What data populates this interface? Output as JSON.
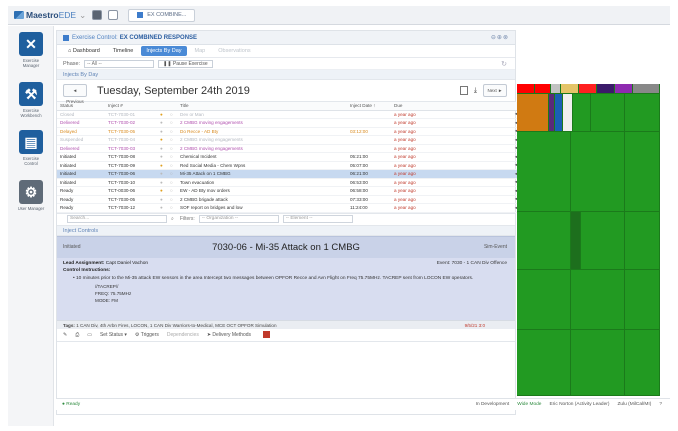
{
  "topbar": {
    "app_name": "Maestro",
    "app_suffix": "EDE",
    "tab_label": "EX COMBINE..."
  },
  "leftnav": [
    {
      "label": "Exercise Manager",
      "icon": "tools-x-icon"
    },
    {
      "label": "Exercise Workbench",
      "icon": "wrench-icon"
    },
    {
      "label": "Exercise Control",
      "icon": "control-panel-icon"
    },
    {
      "label": "User Manager",
      "icon": "gear-icon"
    }
  ],
  "main": {
    "header_prefix": "Exercise Control:",
    "header_title": "EX COMBINED RESPONSE",
    "tabs": [
      {
        "label": "Dashboard",
        "state": "normal"
      },
      {
        "label": "Timeline",
        "state": "normal"
      },
      {
        "label": "Injects By Day",
        "state": "active"
      },
      {
        "label": "Map",
        "state": "muted"
      },
      {
        "label": "Observations",
        "state": "muted"
      }
    ],
    "phase_label": "Phase:",
    "phase_value": "-- All --",
    "pause_label": "Pause Exercise",
    "section_title": "Injects By Day",
    "prev_label": "◄ Previous",
    "next_label": "Next ►",
    "date": "Tuesday, September 24th 2019",
    "columns": [
      "Status",
      "Inject #",
      "",
      "",
      "Title",
      "Inject Date ↑",
      "Due",
      ""
    ],
    "rows": [
      {
        "status": "Closed",
        "num": "TCT-7030-01",
        "title": "Dev or Man",
        "date": "",
        "due": "a year ago",
        "color": "#b3b8c0",
        "sel": false
      },
      {
        "status": "Delivered",
        "num": "TCT-7030-02",
        "title": "2 CMBG moving engagements",
        "date": "",
        "due": "a year ago",
        "color": "#b04fae",
        "sel": false
      },
      {
        "status": "Delayed",
        "num": "TCT-7030-05",
        "title": "Do Recce - AD Bty",
        "date": "03:12:00",
        "due": "a year ago",
        "color": "#d98a1e",
        "sel": false
      },
      {
        "status": "Suspended",
        "num": "TCT-7030-04",
        "title": "2 CMBG moving engagements",
        "date": "",
        "due": "a year ago",
        "color": "#b3b8c0",
        "sel": false
      },
      {
        "status": "Delivered",
        "num": "TCT-7030-03",
        "title": "2 CMBG moving engagements",
        "date": "",
        "due": "a year ago",
        "color": "#b04fae",
        "sel": false
      },
      {
        "status": "Initiated",
        "num": "TCT-7030-08",
        "title": "Chemical Incident",
        "date": "05:21:00",
        "due": "a year ago",
        "color": "#333333",
        "sel": false
      },
      {
        "status": "Initiated",
        "num": "TCT-7030-09",
        "title": "Red Social Media - Chem Wpns",
        "date": "05:07:00",
        "due": "a year ago",
        "color": "#333333",
        "sel": false
      },
      {
        "status": "Initiated",
        "num": "TCT-7030-06",
        "title": "Mi-35 Attack on 1 CMBG",
        "date": "06:21:00",
        "due": "a year ago",
        "color": "#333333",
        "sel": true
      },
      {
        "status": "Initiated",
        "num": "TCT-7030-10",
        "title": "Town evacuation",
        "date": "06:53:00",
        "due": "a year ago",
        "color": "#333333",
        "sel": false
      },
      {
        "status": "Ready",
        "num": "TCT-0030-06",
        "title": "EW - AD Bty mov orders",
        "date": "06:58:00",
        "due": "a year ago",
        "color": "#333333",
        "sel": false
      },
      {
        "status": "Ready",
        "num": "TCT-7030-05",
        "title": "2 CMBG brigade attack",
        "date": "07:33:00",
        "due": "a year ago",
        "color": "#333333",
        "sel": false
      },
      {
        "status": "Ready",
        "num": "TCT-7030-12",
        "title": "SOF report on bridges and low",
        "date": "11:24:00",
        "due": "a year ago",
        "color": "#333333",
        "sel": false
      }
    ],
    "search_placeholder": "Search...",
    "filters_label": "Filters:",
    "org_filter": "-- Organization --",
    "elem_filter": "-- Element --",
    "inject_controls_title": "Inject Controls",
    "inject": {
      "status": "Initiated",
      "title": "7030-06 - Mi-35 Attack on 1 CMBG",
      "type": "Sim-Event",
      "lead_label": "Lead Assignment:",
      "lead_value": "Capt Daniel Vachon",
      "event_label": "Event: 7030 - 1 CAN Div Offence",
      "instructions_label": "Control Instructions:",
      "bullet": "10 minutes prior to the Mi-35 attack EW sensors in the area Intercept two messages between OPFOR Recce and Avn Flight on Freq 75.75MHz. TACREP sent from LOCON EW operators.",
      "sub_lines": [
        "//TACREP//",
        "FREQ: 75.75MHz",
        "MODE: FM"
      ],
      "tags_label": "Tags:",
      "tags_value": "1 CAN Div, 4th Arbn Fires, LOCON, 1 CAN Div Warriors-to-Medical, MCE OCT OPFOR Simulation",
      "tags_date": "9/5/21 3:0"
    },
    "toolbar": [
      "Set Status ▾",
      "Triggers",
      "Dependencies",
      "Delivery Methods"
    ]
  },
  "statusbar": {
    "ready": "Ready",
    "mode": "In Development",
    "wide": "Wide Mode",
    "user": "Eric Norton (Activity Leader)",
    "zone": "Zulu (MilCal/MI)"
  },
  "colors": {
    "accent": "#4a8ad6",
    "map_green": "#229a22"
  }
}
